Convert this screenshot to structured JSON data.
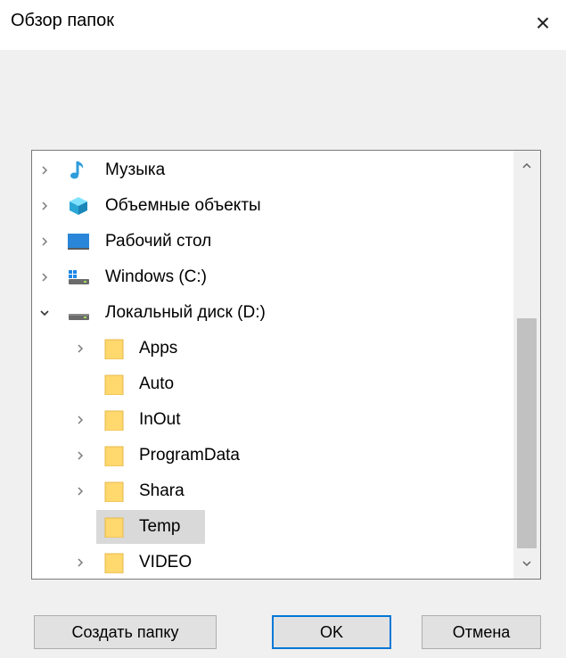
{
  "window": {
    "title": "Обзор папок",
    "close_icon": "×"
  },
  "tree": {
    "items": [
      {
        "label": "Музыка",
        "icon": "music-icon",
        "expander": "collapsed"
      },
      {
        "label": "Объемные объекты",
        "icon": "3d-objects-icon",
        "expander": "collapsed"
      },
      {
        "label": "Рабочий стол",
        "icon": "desktop-icon",
        "expander": "collapsed"
      },
      {
        "label": "Windows (C:)",
        "icon": "system-drive-icon",
        "expander": "collapsed"
      },
      {
        "label": "Локальный диск (D:)",
        "icon": "drive-icon",
        "expander": "expanded"
      },
      {
        "label": "Apps",
        "icon": "folder-icon",
        "expander": "collapsed"
      },
      {
        "label": "Auto",
        "icon": "folder-icon",
        "expander": "none"
      },
      {
        "label": "InOut",
        "icon": "folder-icon",
        "expander": "collapsed"
      },
      {
        "label": "ProgramData",
        "icon": "folder-icon",
        "expander": "collapsed"
      },
      {
        "label": "Shara",
        "icon": "folder-icon",
        "expander": "collapsed"
      },
      {
        "label": "Temp",
        "icon": "folder-icon",
        "expander": "none",
        "selected": true
      },
      {
        "label": "VIDEO",
        "icon": "folder-icon",
        "expander": "collapsed"
      }
    ]
  },
  "buttons": {
    "new_folder": "Создать папку",
    "ok": "OK",
    "cancel": "Отмена"
  },
  "colors": {
    "accent": "#0078d7",
    "selection": "#d9d9d9",
    "folder": "#ffd86e"
  }
}
